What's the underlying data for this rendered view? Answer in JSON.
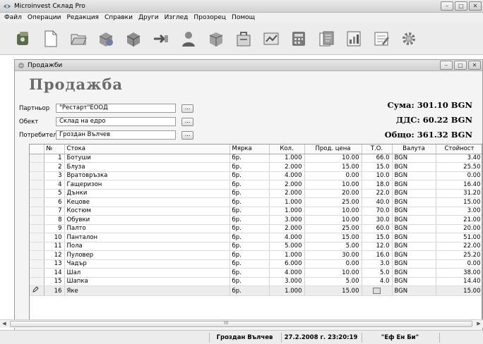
{
  "app": {
    "title": "Microinvest Склад Pro",
    "window_buttons": [
      "–",
      "□",
      "✕"
    ]
  },
  "menu": [
    "Файл",
    "Операции",
    "Редакция",
    "Справки",
    "Други",
    "Изглед",
    "Прозорец",
    "Помощ"
  ],
  "toolbar_icons": [
    "exit-icon",
    "new-document-icon",
    "open-icon",
    "sale-icon",
    "delivery-icon",
    "transfer-icon",
    "partner-icon",
    "goods-icon",
    "documents-icon",
    "reports-icon",
    "calculator-icon",
    "invoice-icon",
    "chart-icon",
    "notes-icon",
    "settings-icon"
  ],
  "child_window": {
    "title": "Продажби",
    "heading": "Продажба"
  },
  "fields": {
    "partner": {
      "label": "Партньор",
      "value": "\"Рестарт\"ЕООД",
      "button": "..."
    },
    "object": {
      "label": "Обект",
      "value": "Склад на едро",
      "button": "..."
    },
    "user": {
      "label": "Потребител",
      "value": "Гроздан Вълчев",
      "button": "..."
    }
  },
  "totals": {
    "sum": "Сума: 301.10 BGN",
    "vat": "ДДС: 60.22 BGN",
    "total": "Общо: 361.32 BGN"
  },
  "grid": {
    "columns": [
      "",
      "№",
      "Стока",
      "Мярка",
      "Кол.",
      "Прод. цена",
      "Т.О.",
      "Валута",
      "Стойност"
    ],
    "rows": [
      [
        "1",
        "Ботуши",
        "бр.",
        "1.000",
        "10.00",
        "66.0",
        "BGN",
        "3.40"
      ],
      [
        "2",
        "Блуза",
        "бр.",
        "2.000",
        "15.00",
        "15.0",
        "BGN",
        "25.50"
      ],
      [
        "3",
        "Вратовръзка",
        "бр.",
        "4.000",
        "0.00",
        "10.0",
        "BGN",
        "0.00"
      ],
      [
        "4",
        "Гащеризон",
        "бр.",
        "2.000",
        "10.00",
        "18.0",
        "BGN",
        "16.40"
      ],
      [
        "5",
        "Дънки",
        "бр.",
        "2.000",
        "20.00",
        "22.0",
        "BGN",
        "31.20"
      ],
      [
        "6",
        "Кецове",
        "бр.",
        "1.000",
        "25.00",
        "40.0",
        "BGN",
        "15.00"
      ],
      [
        "7",
        "Костюм",
        "бр.",
        "1.000",
        "10.00",
        "70.0",
        "BGN",
        "3.00"
      ],
      [
        "8",
        "Обувки",
        "бр.",
        "3.000",
        "10.00",
        "30.0",
        "BGN",
        "21.00"
      ],
      [
        "9",
        "Палто",
        "бр.",
        "2.000",
        "25.00",
        "60.0",
        "BGN",
        "20.00"
      ],
      [
        "10",
        "Панталон",
        "бр.",
        "4.000",
        "15.00",
        "15.0",
        "BGN",
        "51.00"
      ],
      [
        "11",
        "Пола",
        "бр.",
        "5.000",
        "5.00",
        "12.0",
        "BGN",
        "22.00"
      ],
      [
        "12",
        "Пуловер",
        "бр.",
        "1.000",
        "30.00",
        "16.0",
        "BGN",
        "25.20"
      ],
      [
        "13",
        "Чадър",
        "бр.",
        "6.000",
        "0.00",
        "3.0",
        "BGN",
        "0.00"
      ],
      [
        "14",
        "Шал",
        "бр.",
        "4.000",
        "10.00",
        "5.0",
        "BGN",
        "38.00"
      ],
      [
        "15",
        "Шапка",
        "бр.",
        "3.000",
        "5.00",
        "4.0",
        "BGN",
        "14.40"
      ],
      [
        "16",
        "Яке",
        "бр.",
        "1.000",
        "15.00",
        "",
        "BGN",
        "15.00"
      ]
    ]
  },
  "scrollbar": {
    "grip": "III"
  },
  "status": {
    "user": "Гроздан Вълчев",
    "datetime": "27.2.2008 г. 23:20:19",
    "company": "\"Еф Ен Би\""
  },
  "colors": {
    "heading": "#6b6b6b",
    "background": "#f4f4f4"
  }
}
